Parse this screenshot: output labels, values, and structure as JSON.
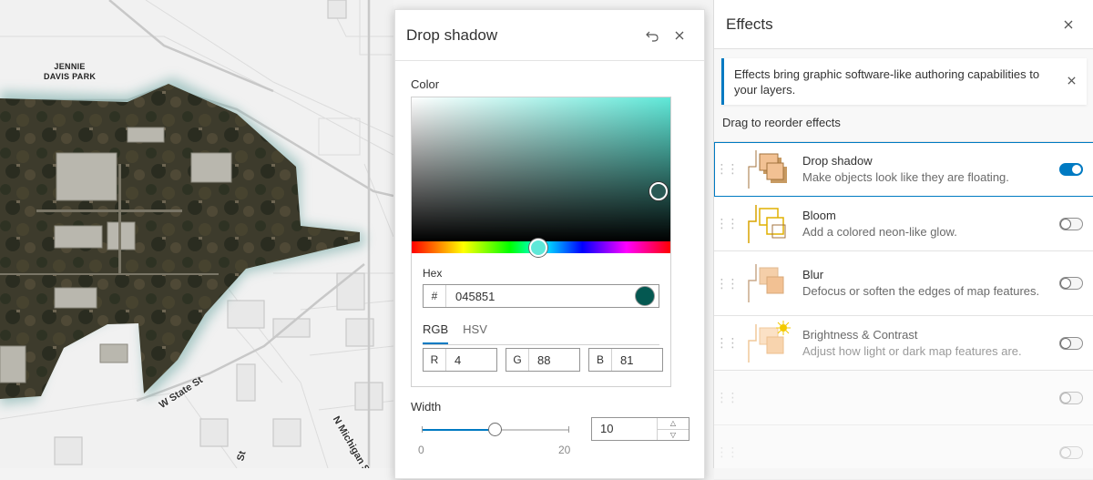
{
  "map": {
    "park_label": "JENNIE\nDAVIS PARK",
    "street_labels": [
      "W State St",
      "N Michigan St",
      "St"
    ]
  },
  "drop_shadow_panel": {
    "title": "Drop shadow",
    "undo_icon": "undo-icon",
    "close_icon": "close-icon",
    "color_label": "Color",
    "hex_label": "Hex",
    "hex_prefix": "#",
    "hex_value": "045851",
    "swatch_color": "#045851",
    "tabs": [
      {
        "label": "RGB",
        "active": true
      },
      {
        "label": "HSV",
        "active": false
      }
    ],
    "channels": [
      {
        "label": "R",
        "value": "4"
      },
      {
        "label": "G",
        "value": "88"
      },
      {
        "label": "B",
        "value": "81"
      }
    ],
    "width_label": "Width",
    "width_value": "10",
    "width_min": "0",
    "width_max": "20"
  },
  "effects_panel": {
    "title": "Effects",
    "notice": "Effects bring graphic software-like authoring capabilities to your layers.",
    "drag_label": "Drag to reorder effects",
    "items": [
      {
        "name": "Drop shadow",
        "description": "Make objects look like they are floating.",
        "enabled": true
      },
      {
        "name": "Bloom",
        "description": "Add a colored neon-like glow.",
        "enabled": false
      },
      {
        "name": "Blur",
        "description": "Defocus or soften the edges of map features.",
        "enabled": false
      },
      {
        "name": "Brightness & Contrast",
        "description": "Adjust how light or dark map features are.",
        "enabled": false
      },
      {
        "name": "",
        "description": "",
        "enabled": false
      },
      {
        "name": "",
        "description": "",
        "enabled": false
      }
    ]
  },
  "colors": {
    "accent": "#007ac2",
    "thumb_fill": "#f2c193",
    "thumb_stroke": "#a3733c"
  }
}
